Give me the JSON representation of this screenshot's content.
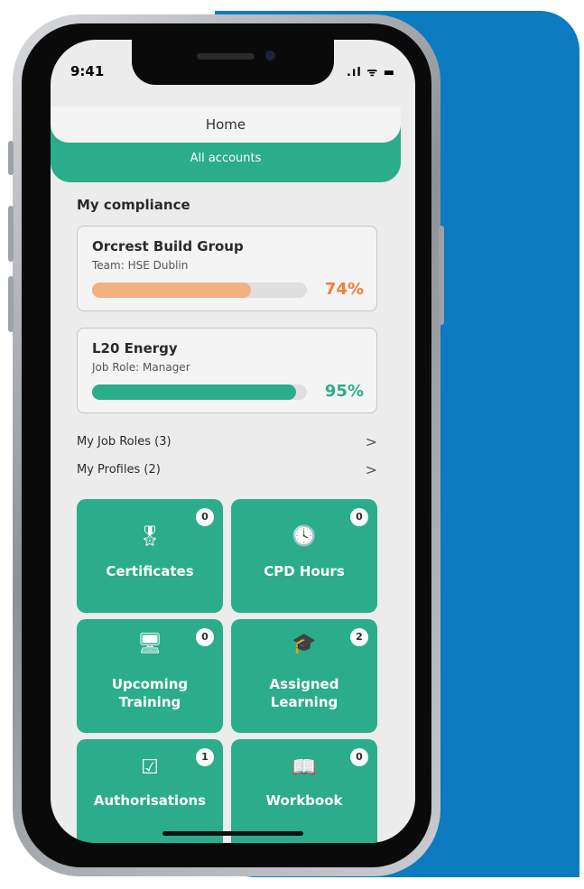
{
  "status_bar": {
    "time": "9:41",
    "signal_icons": ".ıl ᯤ ▬"
  },
  "nav": {
    "home_label": "Home",
    "accounts_label": "All accounts"
  },
  "compliance": {
    "title": "My compliance",
    "cards": [
      {
        "name": "Orcrest Build Group",
        "subtitle": "Team: HSE Dublin",
        "percent_label": "74%",
        "progress": 0.74,
        "color": "#f2b083",
        "text_color": "#f07f3c"
      },
      {
        "name": "L20 Energy",
        "subtitle": "Job Role: Manager",
        "percent_label": "95%",
        "progress": 0.95,
        "color": "#2bac8a",
        "text_color": "#2bac8a"
      }
    ]
  },
  "links": [
    {
      "label": "My Job Roles (3)",
      "chevron": ">"
    },
    {
      "label": "My Profiles (2)",
      "chevron": ">"
    }
  ],
  "tiles": [
    {
      "label": "Certificates",
      "badge": "0",
      "icon": "certificate-icon",
      "glyph": "🎖"
    },
    {
      "label": "CPD Hours",
      "badge": "0",
      "icon": "clock-icon",
      "glyph": "🕓"
    },
    {
      "label": "Upcoming Training",
      "line1": "Upcoming",
      "line2": "Training",
      "badge": "0",
      "icon": "training-screen-icon",
      "glyph": "🖥"
    },
    {
      "label": "Assigned Learning",
      "line1": "Assigned",
      "line2": "Learning",
      "badge": "2",
      "icon": "graduation-cap-icon",
      "glyph": "🎓"
    },
    {
      "label": "Authorisations",
      "badge": "1",
      "icon": "checklist-icon",
      "glyph": "☑"
    },
    {
      "label": "Workbook",
      "badge": "0",
      "icon": "book-icon",
      "glyph": "📖"
    }
  ],
  "colors": {
    "accent": "#2bac8a",
    "brand_blue": "#0c7bbf",
    "warning": "#f07f3c"
  }
}
